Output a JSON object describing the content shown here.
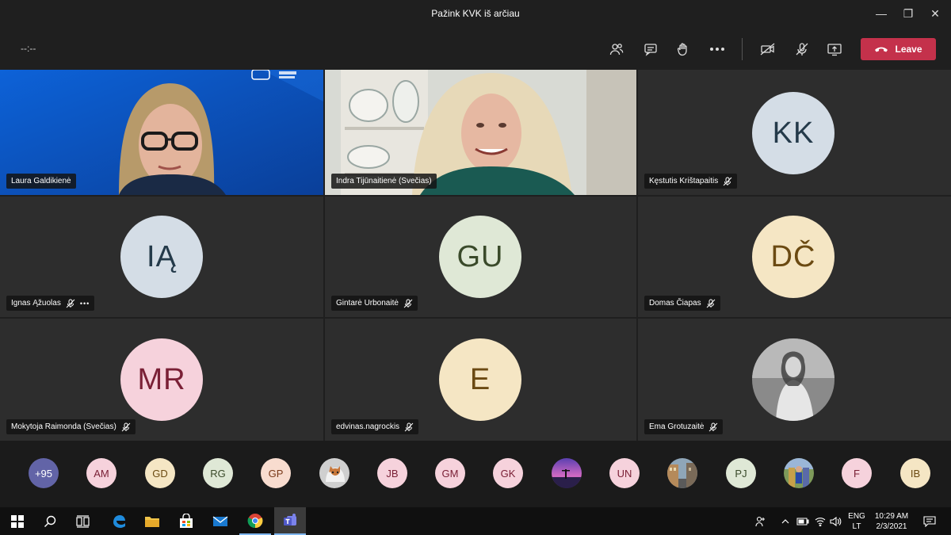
{
  "window": {
    "title": "Pažink KVK iš arčiau",
    "minimize_glyph": "—",
    "restore_glyph": "❐",
    "close_glyph": "✕"
  },
  "toolbar": {
    "timer": "--:--",
    "leave_label": "Leave",
    "icons": [
      "participants-icon",
      "chat-icon",
      "raise-hand-icon",
      "more-options-icon",
      "camera-off-icon",
      "mic-off-icon",
      "share-screen-icon"
    ]
  },
  "tiles": [
    {
      "name": "Laura Galdikienė",
      "type": "video"
    },
    {
      "name": "Indra Tijūnaitienė (Svečias)",
      "type": "video"
    },
    {
      "name": "Kęstutis Krištapaitis",
      "initials": "KK",
      "bg": "#d4dde6",
      "fg": "#243a4a",
      "muted": true
    },
    {
      "name": "Ignas Ąžuolas",
      "initials": "IĄ",
      "bg": "#d4dde6",
      "fg": "#243a4a",
      "muted": true,
      "more": "•••"
    },
    {
      "name": "Gintarė Urbonaitė",
      "initials": "GU",
      "bg": "#dfe8d6",
      "fg": "#3a4a2a",
      "muted": true
    },
    {
      "name": "Domas Čiapas",
      "initials": "DČ",
      "bg": "#f5e6c4",
      "fg": "#6b4a12",
      "muted": true
    },
    {
      "name": "Mokytoja Raimonda (Svečias)",
      "initials": "MR",
      "bg": "#f6d2dc",
      "fg": "#7a2036",
      "muted": true
    },
    {
      "name": "edvinas.nagrockis",
      "initials": "E",
      "bg": "#f5e6c4",
      "fg": "#6b4a12",
      "muted": true
    },
    {
      "name": "Ema Grotuzaitė",
      "type": "photo",
      "muted": true
    }
  ],
  "strip": [
    {
      "label": "+95",
      "bg": "#6264a7",
      "fg": "#ffffff"
    },
    {
      "label": "AM",
      "bg": "#f6d2dc",
      "fg": "#7a2036"
    },
    {
      "label": "GD",
      "bg": "#f5e6c4",
      "fg": "#6b4a12"
    },
    {
      "label": "RG",
      "bg": "#dfe8d6",
      "fg": "#3a4a2a"
    },
    {
      "label": "GP",
      "bg": "#f8dccf",
      "fg": "#7a3a1a"
    },
    {
      "label": "",
      "photo": "cat"
    },
    {
      "label": "JB",
      "bg": "#f6d2dc",
      "fg": "#7a2036"
    },
    {
      "label": "GM",
      "bg": "#f6d2dc",
      "fg": "#7a2036"
    },
    {
      "label": "GK",
      "bg": "#f6d2dc",
      "fg": "#7a2036"
    },
    {
      "label": "",
      "photo": "sunset"
    },
    {
      "label": "UN",
      "bg": "#f6d2dc",
      "fg": "#7a2036"
    },
    {
      "label": "",
      "photo": "street"
    },
    {
      "label": "PJ",
      "bg": "#dfe8d6",
      "fg": "#3a4a2a"
    },
    {
      "label": "",
      "photo": "figure"
    },
    {
      "label": "F",
      "bg": "#f6d2dc",
      "fg": "#7a2036"
    },
    {
      "label": "IB",
      "bg": "#f5e6c4",
      "fg": "#6b4a12"
    }
  ],
  "taskbar": {
    "lang_top": "ENG",
    "lang_bottom": "LT",
    "time": "10:29 AM",
    "date": "2/3/2021"
  }
}
